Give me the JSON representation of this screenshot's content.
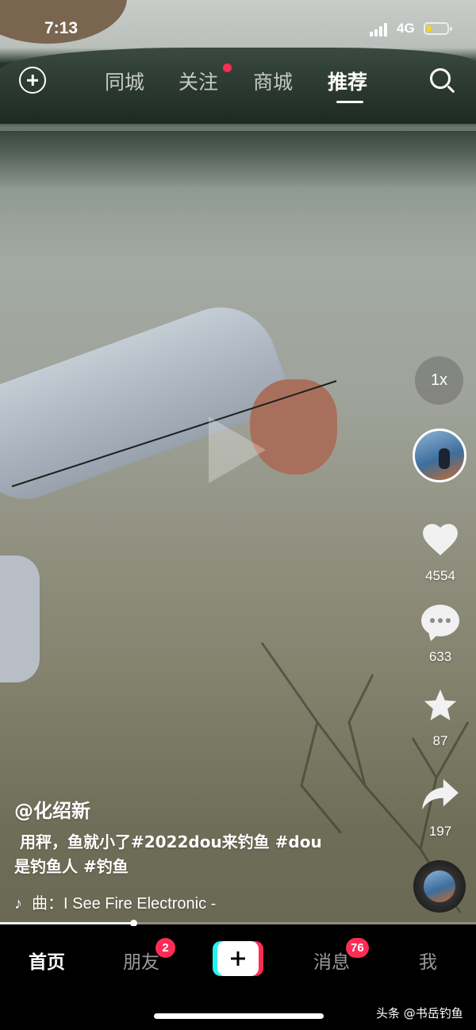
{
  "status_bar": {
    "time": "7:13",
    "network": "4G",
    "battery_level": 0.2
  },
  "top_nav": {
    "tabs": [
      {
        "label": "同城"
      },
      {
        "label": "关注",
        "has_dot": true
      },
      {
        "label": "商城"
      },
      {
        "label": "推荐",
        "active": true
      }
    ]
  },
  "sidebar": {
    "speed_label": "1x",
    "likes": "4554",
    "comments": "633",
    "favorites": "87",
    "shares": "197"
  },
  "video_info": {
    "author": "@化绍新",
    "caption": " 用秤，鱼就小了#2022dou来钓鱼 #dou\n是钓鱼人 #钓鱼",
    "music": "曲：I See Fire Electronic -",
    "progress": 0.28
  },
  "bottom_nav": {
    "items": [
      {
        "label": "首页",
        "active": true
      },
      {
        "label": "朋友",
        "badge": "2"
      },
      {
        "label": "消息",
        "badge": "76"
      },
      {
        "label": "我"
      }
    ]
  },
  "watermark": "头条 @书岳钓鱼",
  "colors": {
    "accent_red": "#fe2c55",
    "accent_cyan": "#25f4ee",
    "battery": "#ffd60a"
  }
}
